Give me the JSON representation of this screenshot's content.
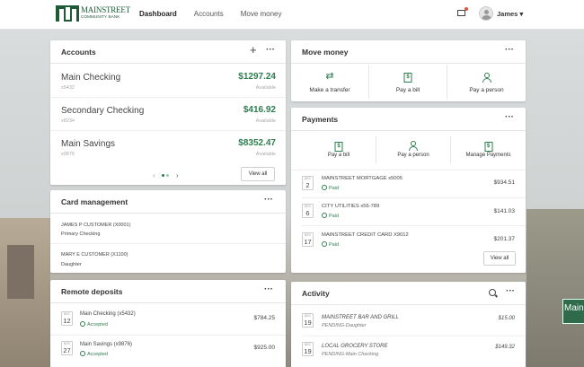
{
  "header": {
    "logo_name": "MAINSTREET",
    "logo_sub": "COMMUNITY BANK",
    "nav": [
      "Dashboard",
      "Accounts",
      "Move money"
    ],
    "user": "James"
  },
  "accounts": {
    "title": "Accounts",
    "items": [
      {
        "name": "Main Checking",
        "number": "x5432",
        "amount": "$1297.24",
        "avail": "Available"
      },
      {
        "name": "Secondary Checking",
        "number": "x8234",
        "amount": "$416.92",
        "avail": "Available"
      },
      {
        "name": "Main Savings",
        "number": "x9876",
        "amount": "$8352.47",
        "avail": "Available"
      }
    ],
    "view_all": "View all"
  },
  "card_management": {
    "title": "Card management",
    "items": [
      {
        "name": "JAMES P CUSTOMER (X0001)",
        "type": "Primary Checking"
      },
      {
        "name": "MARY E CUSTOMER (X1100)",
        "type": "Daughter"
      }
    ]
  },
  "remote_deposits": {
    "title": "Remote deposits",
    "items": [
      {
        "month": "DEC",
        "day": "12",
        "name": "Main Checking (x5432)",
        "status": "Accepted",
        "amount": "$784.25"
      },
      {
        "month": "NOV",
        "day": "27",
        "name": "Main Savings (x9876)",
        "status": "Accepted",
        "amount": "$925.00"
      }
    ]
  },
  "move_money": {
    "title": "Move money",
    "actions": [
      "Make a transfer",
      "Pay a bill",
      "Pay a person"
    ]
  },
  "payments": {
    "title": "Payments",
    "actions": [
      "Pay a bill",
      "Pay a person",
      "Manage Payments"
    ],
    "items": [
      {
        "month": "DEC",
        "day": "2",
        "name": "MAINSTREET MORTGAGE x5005",
        "status": "Paid",
        "amount": "$934.51"
      },
      {
        "month": "DEC",
        "day": "6",
        "name": "CITY UTILITIES x56-789",
        "status": "Paid",
        "amount": "$141.03"
      },
      {
        "month": "DEC",
        "day": "17",
        "name": "MAINSTREET CREDIT CARD X9012",
        "status": "Paid",
        "amount": "$201.37"
      }
    ],
    "view_all": "View all"
  },
  "activity": {
    "title": "Activity",
    "items": [
      {
        "month": "DEC",
        "day": "19",
        "name": "MAINSTREET BAR AND GRILL",
        "sub": "PENDING-Daughter",
        "amount": "$15.00"
      },
      {
        "month": "DEC",
        "day": "19",
        "name": "LOCAL GROCERY STORE",
        "sub": "PENDING-Main Checking",
        "amount": "$149.32"
      }
    ]
  },
  "colors": {
    "brand": "#1e5a36",
    "accent": "#2e7d4f"
  },
  "background": {
    "sign_text": "Main"
  }
}
